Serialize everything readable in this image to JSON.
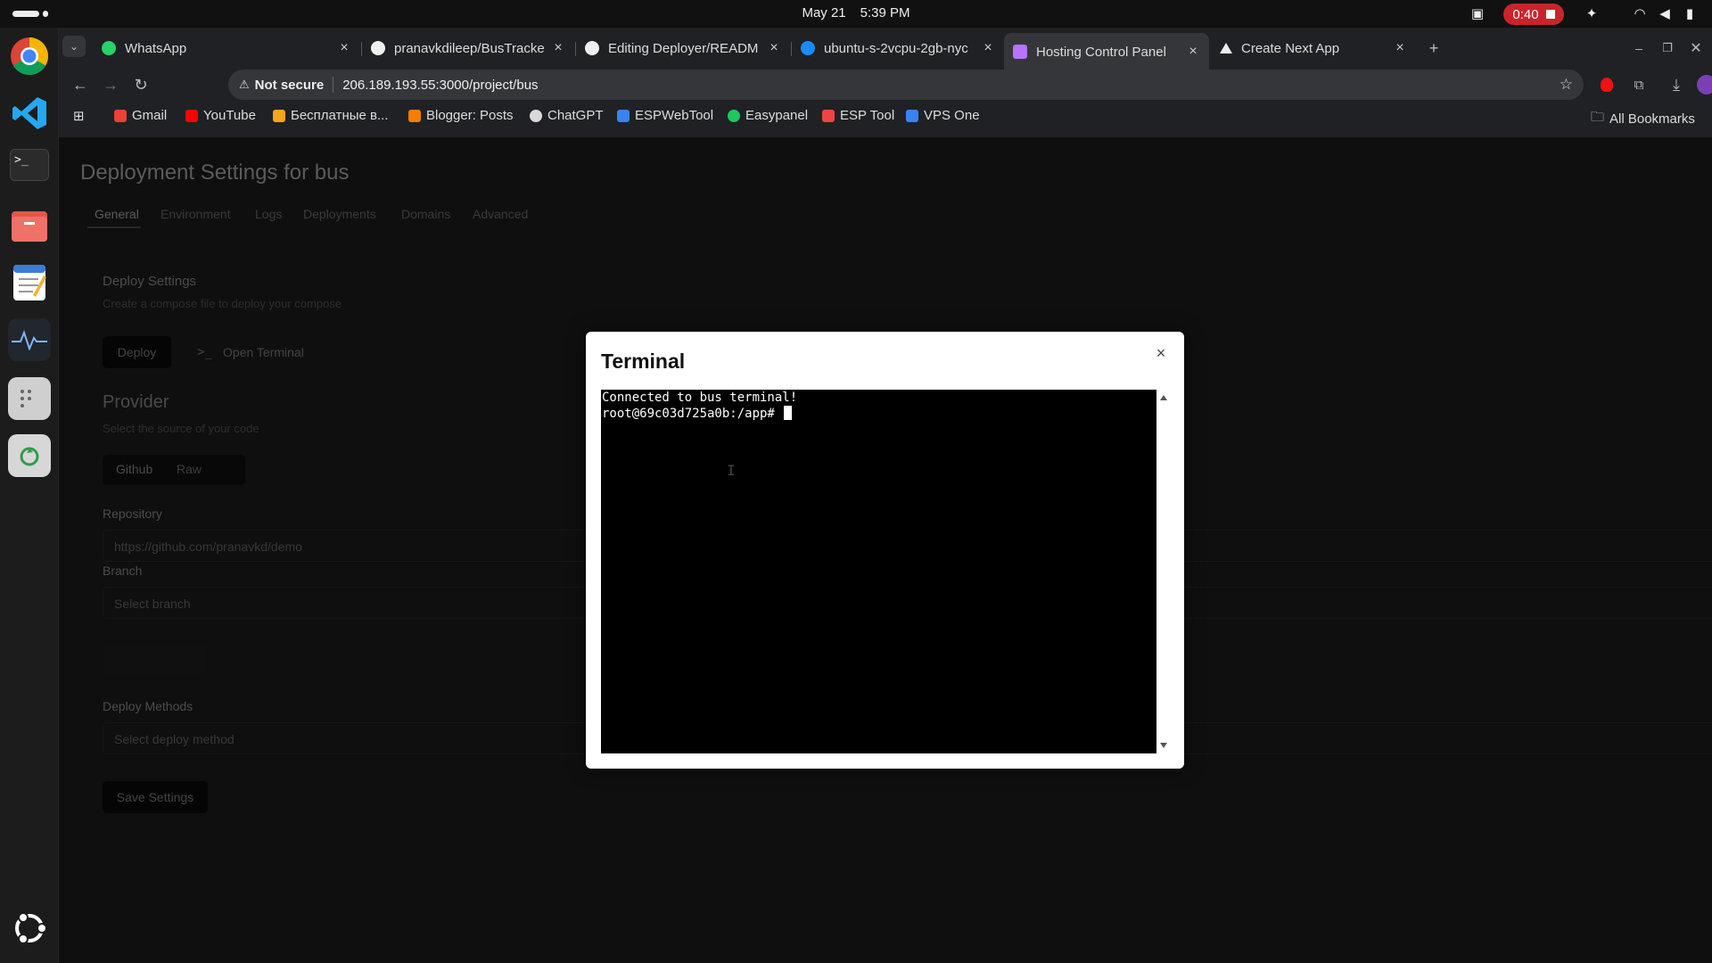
{
  "topbar": {
    "date": "May 21",
    "time": "5:39 PM",
    "recording": "0:40"
  },
  "tabs": [
    {
      "title": "WhatsApp",
      "icon": "whatsapp-icon",
      "color": "#25d366"
    },
    {
      "title": "pranavkdileep/BusTracke",
      "icon": "github-icon",
      "color": "#f0f0f0"
    },
    {
      "title": "Editing Deployer/READM",
      "icon": "github-icon",
      "color": "#f0f0f0"
    },
    {
      "title": "ubuntu-s-2vcpu-2gb-nyc",
      "icon": "digitalocean-icon",
      "color": "#1a8cff"
    },
    {
      "title": "Hosting Control Panel",
      "icon": "vite-icon",
      "color": "#b873ff"
    },
    {
      "title": "Create Next App",
      "icon": "next-icon",
      "color": "#eeeeee"
    }
  ],
  "address": {
    "security": "Not secure",
    "url": "206.189.193.55:3000/project/bus"
  },
  "bookmarks": [
    {
      "label": "Gmail",
      "color": "#ea4335"
    },
    {
      "label": "YouTube",
      "color": "#ff0000"
    },
    {
      "label": "Бесплатные в...",
      "color": "#f7a51c"
    },
    {
      "label": "Blogger: Posts",
      "color": "#f57d00"
    },
    {
      "label": "ChatGPT",
      "color": "#d9d9d9"
    },
    {
      "label": "ESPWebTool",
      "color": "#3b82f6"
    },
    {
      "label": "Easypanel",
      "color": "#22c55e"
    },
    {
      "label": "ESP Tool",
      "color": "#ef4444"
    },
    {
      "label": "VPS One",
      "color": "#3b82f6"
    }
  ],
  "all_bookmarks": "All Bookmarks",
  "page": {
    "title": "Deployment Settings for bus",
    "tabs": [
      "General",
      "Environment",
      "Logs",
      "Deployments",
      "Domains",
      "Advanced"
    ],
    "deploy_settings": {
      "heading": "Deploy Settings",
      "subtitle": "Create a compose file to deploy your compose",
      "deploy_label": "Deploy",
      "terminal_label": "Open Terminal"
    },
    "provider": {
      "heading": "Provider",
      "subtitle": "Select the source of your code",
      "options": [
        "Github",
        "Raw"
      ]
    },
    "repository": {
      "label": "Repository",
      "placeholder": "https://github.com/pranavkd/demo"
    },
    "branch": {
      "label": "Branch",
      "placeholder": "Select branch"
    },
    "deploy_methods": {
      "label": "Deploy Methods",
      "placeholder": "Select deploy method"
    },
    "save_label": "Save Settings"
  },
  "modal": {
    "title": "Terminal",
    "close": "×",
    "lines": [
      "Connected to bus terminal!",
      "root@69c03d725a0b:/app# "
    ]
  }
}
